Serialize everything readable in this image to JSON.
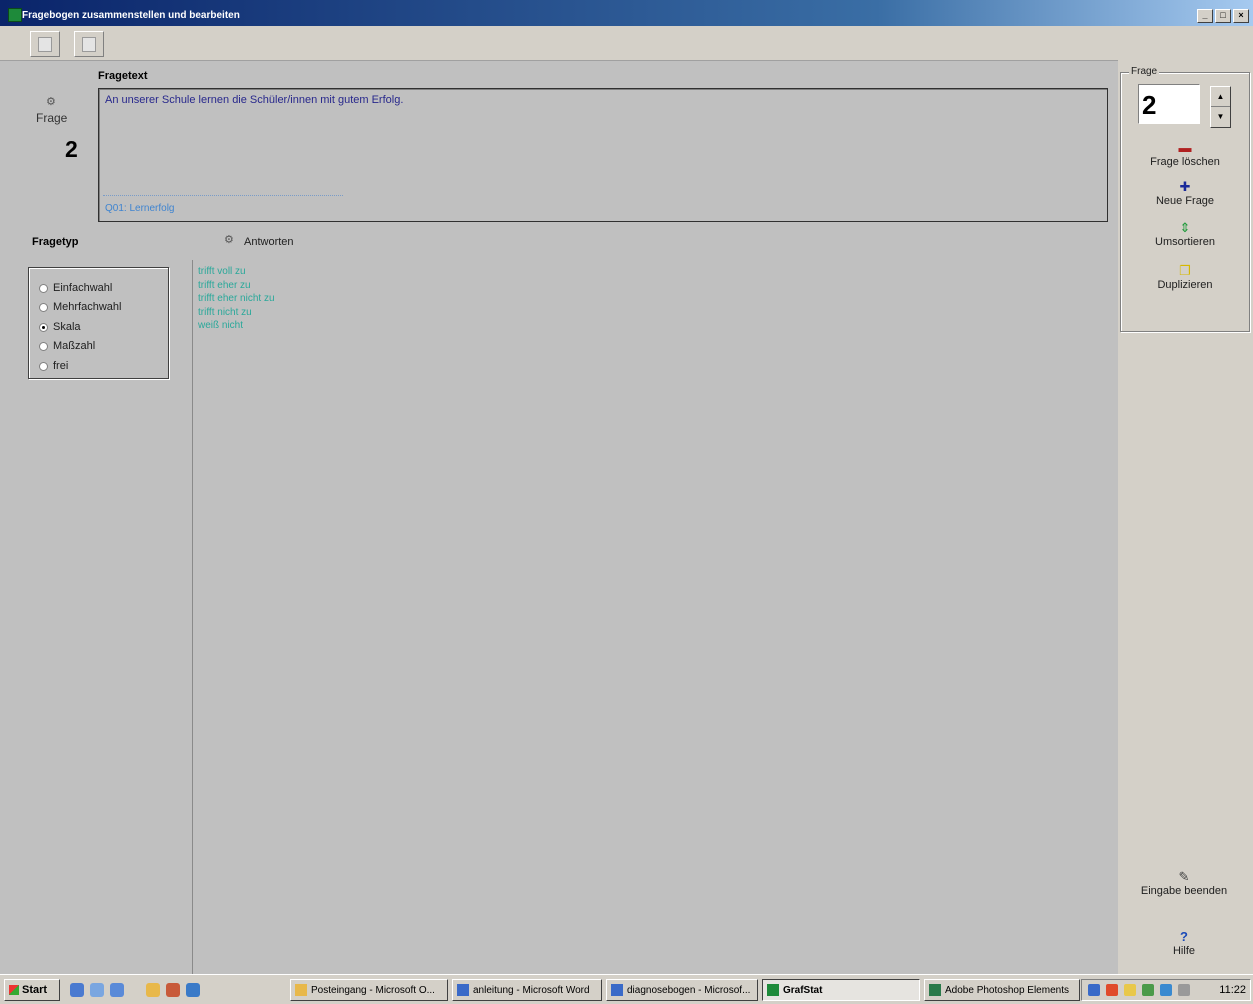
{
  "window": {
    "title": "Fragebogen zusammenstellen und bearbeiten",
    "btn_min": "_",
    "btn_max": "□",
    "btn_close": "×"
  },
  "left": {
    "frage_label": "Frage",
    "frage_number": "2",
    "fragetext_heading": "Fragetext",
    "fragetext_value": "An unserer Schule lernen die Schüler/innen mit gutem Erfolg.",
    "category": "Q01: Lernerfolg",
    "fragetyp_heading": "Fragetyp",
    "fragetyp_options": [
      "Einfachwahl",
      "Mehrfachwahl",
      "Skala",
      "Maßzahl",
      "frei"
    ],
    "fragetyp_selected": "Skala",
    "antworten_heading": "Antworten",
    "answers": [
      "trifft voll zu",
      "trifft eher zu",
      "trifft eher nicht zu",
      "trifft nicht zu",
      "weiß nicht"
    ]
  },
  "right": {
    "group_legend": "Frage",
    "question_number": "2",
    "delete_label": "Frage löschen",
    "new_label": "Neue Frage",
    "sort_label": "Umsortieren",
    "duplicate_label": "Duplizieren",
    "finish_label": "Eingabe beenden",
    "help_label": "Hilfe"
  },
  "colors": {
    "question_text": "#28288c",
    "category_text": "#3f84d0",
    "answer_text": "#2aa89a",
    "delete_icon": "#b02020",
    "new_icon": "#1a2a9a",
    "sort_icon": "#1e9a3a",
    "duplicate_icon": "#d6b800",
    "help_icon": "#1a4ab8"
  },
  "taskbar": {
    "start_label": "Start",
    "tasks": [
      "Posteingang - Microsoft O...",
      "anleitung - Microsoft Word",
      "diagnosebogen - Microsof...",
      "GrafStat",
      "Adobe Photoshop Elements"
    ],
    "clock": "11:22"
  }
}
